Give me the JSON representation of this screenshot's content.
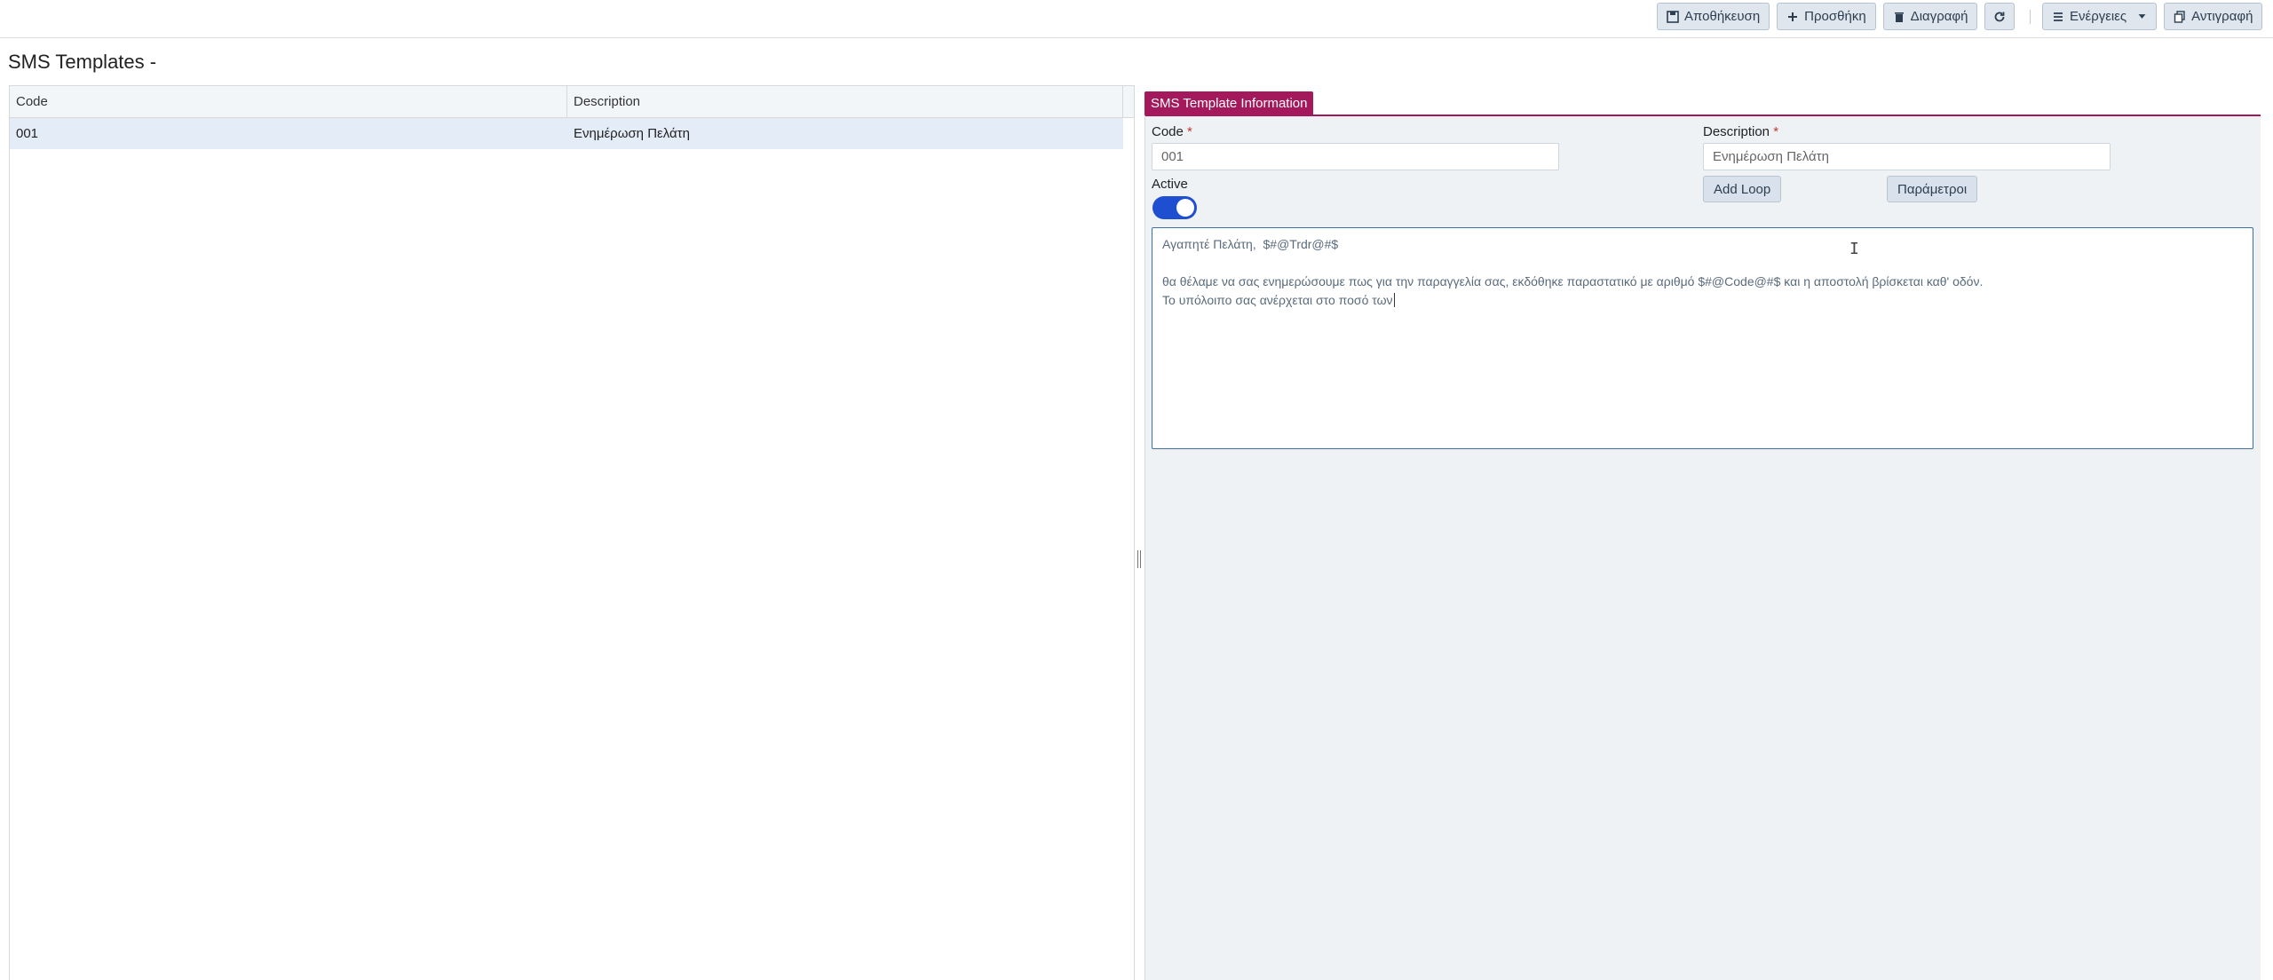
{
  "toolbar": {
    "save": "Αποθήκευση",
    "add": "Προσθήκη",
    "delete": "Διαγραφή",
    "refresh_icon": "refresh-icon",
    "actions": "Ενέργειες",
    "copy": "Αντιγραφή"
  },
  "page": {
    "title": "SMS Templates -"
  },
  "grid": {
    "columns": [
      "Code",
      "Description"
    ],
    "rows": [
      {
        "code": "001",
        "description": "Ενημέρωση Πελάτη"
      }
    ]
  },
  "form": {
    "tab_label": "SMS Template Information",
    "code_label": "Code",
    "code_value": "001",
    "description_label": "Description",
    "description_value": "Ενημέρωση Πελάτη",
    "required_mark": "*",
    "active_label": "Active",
    "active": true,
    "add_loop": "Add Loop",
    "parameters": "Παράμετροι",
    "body_lines": [
      "Αγαπητέ Πελάτη,  $#@Trdr@#$",
      "",
      "θα θέλαμε να σας ενημερώσουμε πως για την παραγγελία σας, εκδόθηκε παραστατικό με αριθμό $#@Code@#$ και η αποστολή βρίσκεται καθ' οδόν.",
      "Το υπόλοιπο σας ανέρχεται στο ποσό των"
    ]
  },
  "colors": {
    "accent": "#a3195b",
    "toggle": "#1f4fd1",
    "selected_row": "#e4ecf7",
    "panel_bg": "#eef2f5"
  }
}
